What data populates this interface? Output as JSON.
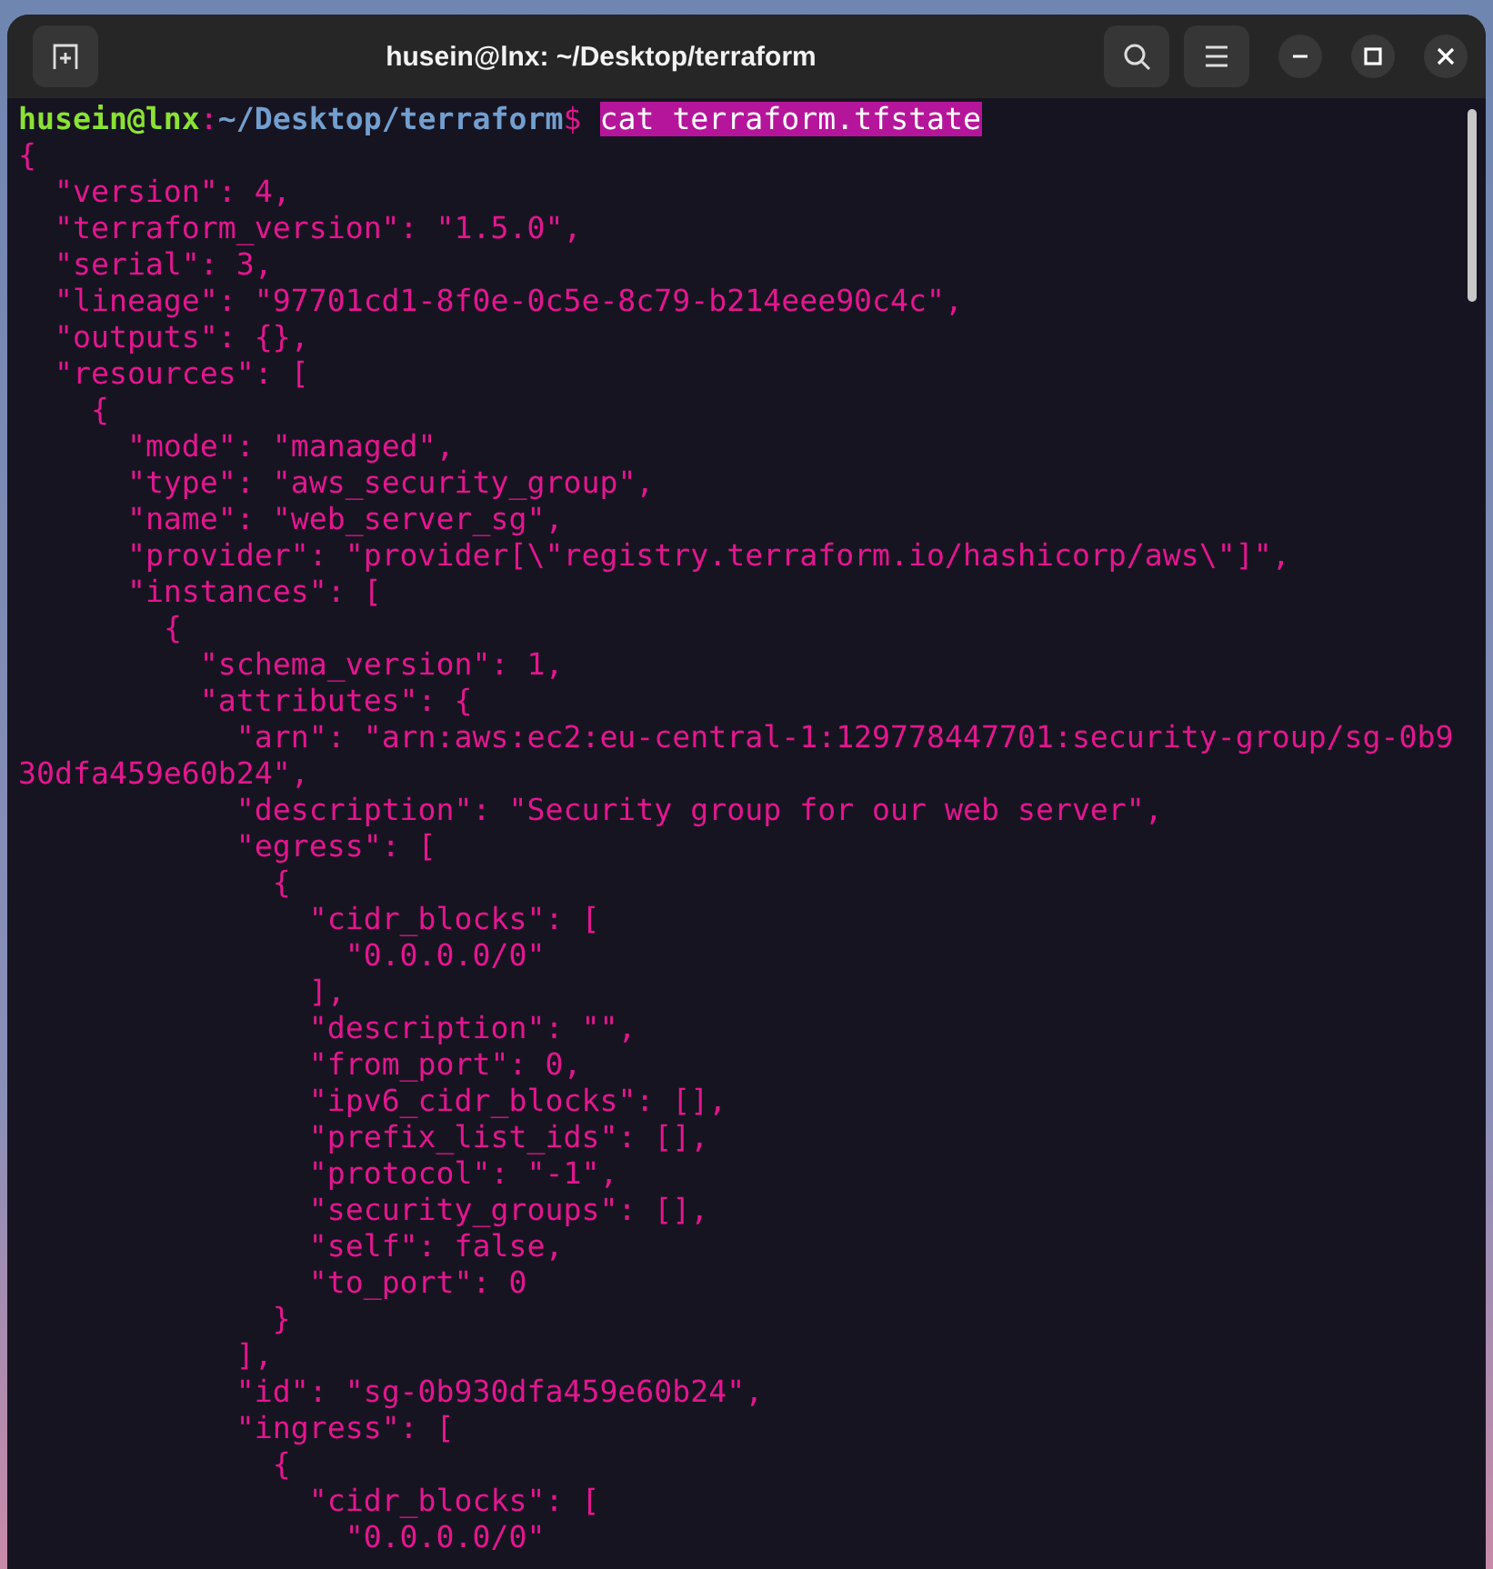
{
  "window": {
    "title": "husein@lnx: ~/Desktop/terraform"
  },
  "terminal": {
    "prompt": {
      "user_host": "husein@lnx",
      "separator": ":",
      "path": "~/Desktop/terraform",
      "symbol": "$",
      "command": "cat terraform.tfstate",
      "selected": true
    },
    "output": [
      "{",
      "  \"version\": 4,",
      "  \"terraform_version\": \"1.5.0\",",
      "  \"serial\": 3,",
      "  \"lineage\": \"97701cd1-8f0e-0c5e-8c79-b214eee90c4c\",",
      "  \"outputs\": {},",
      "  \"resources\": [",
      "    {",
      "      \"mode\": \"managed\",",
      "      \"type\": \"aws_security_group\",",
      "      \"name\": \"web_server_sg\",",
      "      \"provider\": \"provider[\\\"registry.terraform.io/hashicorp/aws\\\"]\",",
      "      \"instances\": [",
      "        {",
      "          \"schema_version\": 1,",
      "          \"attributes\": {",
      "            \"arn\": \"arn:aws:ec2:eu-central-1:129778447701:security-group/sg-0b930dfa459e60b24\",",
      "            \"description\": \"Security group for our web server\",",
      "            \"egress\": [",
      "              {",
      "                \"cidr_blocks\": [",
      "                  \"0.0.0.0/0\"",
      "                ],",
      "                \"description\": \"\",",
      "                \"from_port\": 0,",
      "                \"ipv6_cidr_blocks\": [],",
      "                \"prefix_list_ids\": [],",
      "                \"protocol\": \"-1\",",
      "                \"security_groups\": [],",
      "                \"self\": false,",
      "                \"to_port\": 0",
      "              }",
      "            ],",
      "            \"id\": \"sg-0b930dfa459e60b24\",",
      "            \"ingress\": [",
      "              {",
      "                \"cidr_blocks\": [",
      "                  \"0.0.0.0/0\""
    ]
  }
}
